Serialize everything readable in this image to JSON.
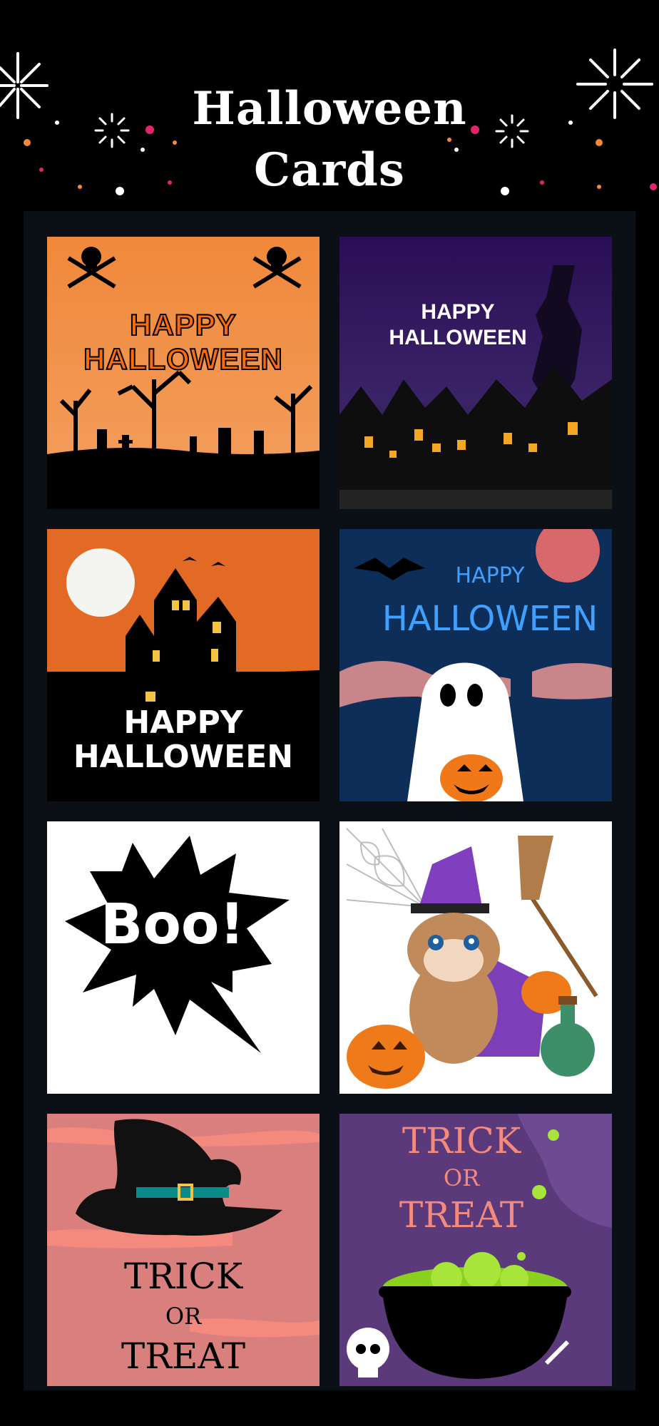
{
  "header": {
    "title_line1": "Halloween",
    "title_line2": "Cards"
  },
  "cards": [
    {
      "line1": "HAPPY HALLOWEEN",
      "line2": "",
      "icon": "skull-crossbones-icon",
      "bg": "#f08a3c"
    },
    {
      "line1": "HAPPY",
      "line2": "HALLOWEEN",
      "icon": "witch-icon",
      "bg": "#3a1d6a"
    },
    {
      "line1": "HAPPY",
      "line2": "HALLOWEEN",
      "icon": "haunted-house-icon",
      "bg": "#e26a25"
    },
    {
      "line1": "HAPPY",
      "line2": "HALLOWEEN",
      "icon": "ghost-icon",
      "bg": "#0e2e5a"
    },
    {
      "line1": "Boo!",
      "line2": "",
      "icon": "speech-burst-icon",
      "bg": "#ffffff"
    },
    {
      "line1": "",
      "line2": "",
      "icon": "hamster-witch-icon",
      "bg": "#ffffff"
    },
    {
      "line1": "TRICK",
      "line2": "OR",
      "line3": "TREAT",
      "icon": "witch-hat-icon",
      "bg": "#d9807f"
    },
    {
      "line1": "TRICK",
      "line2": "OR",
      "line3": "TREAT",
      "icon": "cauldron-icon",
      "bg": "#5a3a7a"
    }
  ]
}
